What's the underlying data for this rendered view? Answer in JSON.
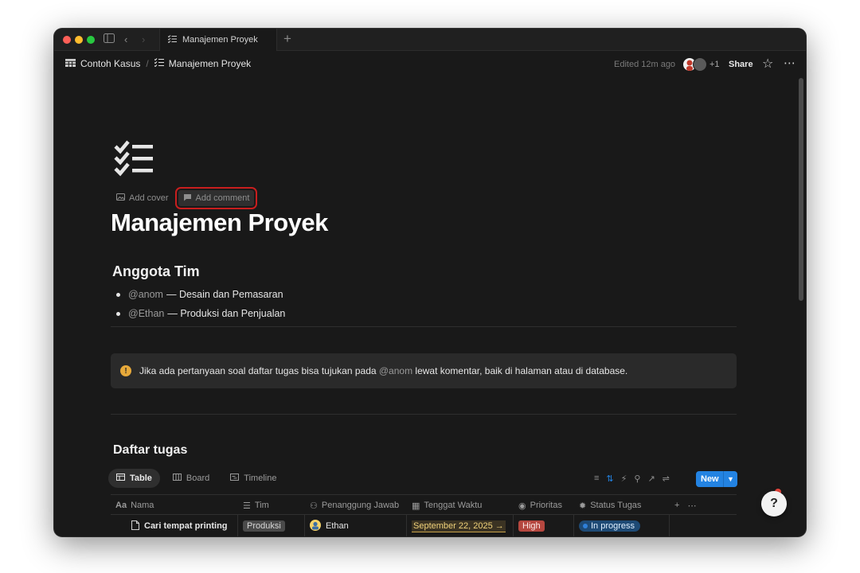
{
  "tab": {
    "title": "Manajemen Proyek"
  },
  "breadcrumb": {
    "parent": "Contoh Kasus",
    "separator": "/",
    "current": "Manajemen Proyek"
  },
  "topbar": {
    "edited": "Edited 12m ago",
    "extra_count": "+1",
    "share": "Share"
  },
  "page": {
    "add_cover": "Add cover",
    "add_comment": "Add comment",
    "title": "Manajemen Proyek",
    "section_team": "Anggota Tim",
    "members": [
      {
        "mention": "@anom",
        "role": "— Desain dan Pemasaran"
      },
      {
        "mention": "@Ethan",
        "role": "— Produksi dan Penjualan"
      }
    ],
    "callout": {
      "before": "Jika ada pertanyaan soal daftar tugas bisa tujukan pada ",
      "mention": "@anom",
      "after": " lewat komentar, baik di halaman atau di database.",
      "icon": "warning-icon",
      "color": "#e7a93a"
    },
    "section_tasks": "Daftar tugas"
  },
  "views": [
    {
      "label": "Table",
      "active": true
    },
    {
      "label": "Board"
    },
    {
      "label": "Timeline"
    }
  ],
  "new_button": "New",
  "columns": [
    "Nama",
    "Tim",
    "Penanggung Jawab",
    "Tenggat Waktu",
    "Prioritas",
    "Status Tugas"
  ],
  "rows": [
    {
      "nama": "Cari tempat printing",
      "tim": "Produksi",
      "pj": "Ethan",
      "tenggat": "September 22, 2025 →",
      "prioritas": "High",
      "status": "In progress"
    }
  ],
  "colors": {
    "accent": "#2383e2",
    "high": "#b5473f",
    "background": "#191919"
  }
}
